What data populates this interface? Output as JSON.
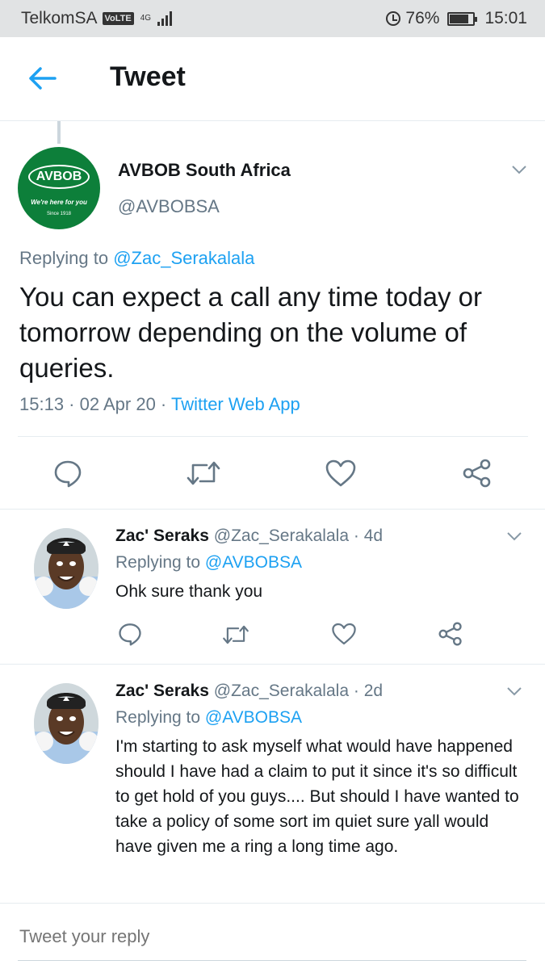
{
  "status_bar": {
    "carrier": "TelkomSA",
    "volte": "VoLTE",
    "network": "4G",
    "battery": "76%",
    "battery_level": 0.76,
    "time": "15:01"
  },
  "header": {
    "title": "Tweet"
  },
  "main_tweet": {
    "name": "AVBOB South Africa",
    "handle": "@AVBOBSA",
    "logo_text": "AVBOB",
    "logo_tagline": "We're here for you",
    "logo_since": "Since 1918",
    "replying_label": "Replying to",
    "replying_handle": "@Zac_Serakalala",
    "text": "You can expect a call any time today or tomorrow depending on the volume of queries.",
    "time": "15:13",
    "date": "02 Apr 20",
    "source": "Twitter Web App"
  },
  "replies": [
    {
      "name": "Zac' Seraks",
      "handle": "@Zac_Serakalala",
      "age": "4d",
      "replying_label": "Replying to",
      "replying_handle": "@AVBOBSA",
      "text": "Ohk sure thank you"
    },
    {
      "name": "Zac' Seraks",
      "handle": "@Zac_Serakalala",
      "age": "2d",
      "replying_label": "Replying to",
      "replying_handle": "@AVBOBSA",
      "text": "I'm starting to ask myself what would have happened should I have had a claim to put it since it's so difficult to get hold of you guys.... But should I have wanted to take a policy of some sort im quiet sure yall would have given me a ring a long time ago."
    }
  ],
  "reply_bar": {
    "placeholder": "Tweet your reply"
  },
  "colors": {
    "accent": "#1da1f2",
    "muted": "#657786",
    "avbob_green": "#0d7f3a"
  },
  "icons": [
    "back-arrow-icon",
    "chevron-down-icon",
    "reply-icon",
    "retweet-icon",
    "like-icon",
    "share-icon",
    "alarm-icon",
    "battery-icon",
    "signal-icon"
  ]
}
